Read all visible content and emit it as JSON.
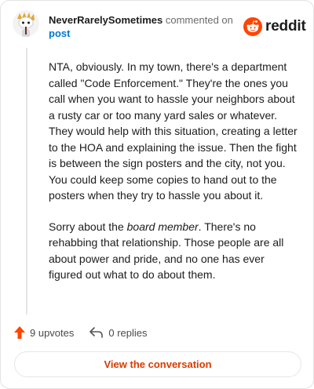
{
  "comment": {
    "author": "NeverRarelySometimes",
    "action": "commented on",
    "post_label": "post",
    "avatar": "snoo-avatar-icon",
    "paragraphs": [
      {
        "text": "NTA, obviously. In my town, there's a department called \"Code Enforcement.\" They're the ones you call when you want to hassle your neighbors about a rusty car or too many yard sales or whatever. They would help with this situation, creating a letter to the HOA and explaining the issue. Then the fight is between the sign posters and the city, not you. You could keep some copies to hand out to the posters when they try to hassle you about it."
      },
      {
        "before": "Sorry about the ",
        "emphasis": "board member",
        "after": ". There's no rehabbing that relationship. Those people are all about power and pride, and no one has ever figured out what to do about them."
      }
    ]
  },
  "brand": {
    "name": "reddit",
    "logo_icon": "reddit-snoo-logo-icon",
    "accent": "#ff4500"
  },
  "stats": {
    "upvotes": "9 upvotes",
    "upvote_icon": "upvote-arrow-icon",
    "replies": "0 replies",
    "reply_icon": "reply-arrow-icon"
  },
  "cta": {
    "label": "View the conversation",
    "color": "#d93a00"
  }
}
